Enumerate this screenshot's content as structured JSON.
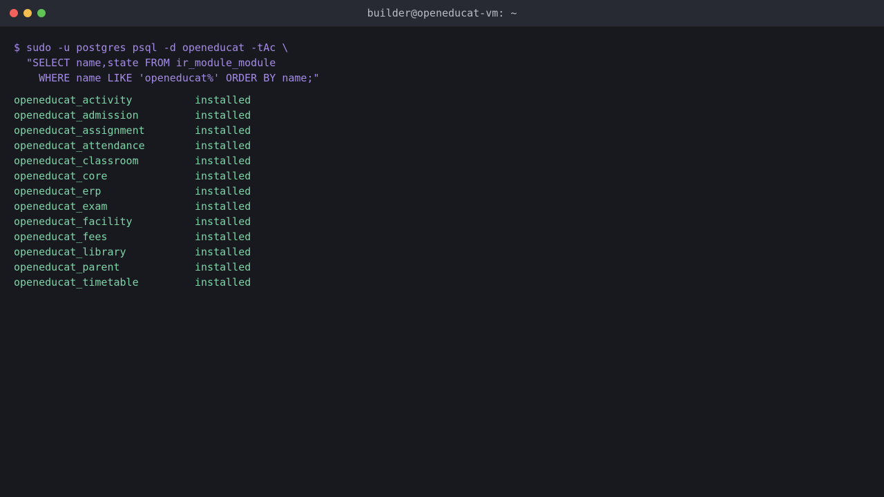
{
  "window": {
    "title": "builder@openeducat-vm: ~",
    "colors": {
      "close": "#f0625b",
      "minimize": "#f4be4f",
      "maximize": "#5fc454",
      "command": "#a48be6",
      "output": "#7ed3a7",
      "background": "#18191e",
      "titlebar": "#272a33"
    }
  },
  "terminal": {
    "command_lines": [
      "$ sudo -u postgres psql -d openeducat -tAc \\",
      "  \"SELECT name,state FROM ir_module_module",
      "    WHERE name LIKE 'openeducat%' ORDER BY name;\""
    ],
    "rows": [
      {
        "name": "openeducat_activity",
        "state": "installed"
      },
      {
        "name": "openeducat_admission",
        "state": "installed"
      },
      {
        "name": "openeducat_assignment",
        "state": "installed"
      },
      {
        "name": "openeducat_attendance",
        "state": "installed"
      },
      {
        "name": "openeducat_classroom",
        "state": "installed"
      },
      {
        "name": "openeducat_core",
        "state": "installed"
      },
      {
        "name": "openeducat_erp",
        "state": "installed"
      },
      {
        "name": "openeducat_exam",
        "state": "installed"
      },
      {
        "name": "openeducat_facility",
        "state": "installed"
      },
      {
        "name": "openeducat_fees",
        "state": "installed"
      },
      {
        "name": "openeducat_library",
        "state": "installed"
      },
      {
        "name": "openeducat_parent",
        "state": "installed"
      },
      {
        "name": "openeducat_timetable",
        "state": "installed"
      }
    ]
  }
}
